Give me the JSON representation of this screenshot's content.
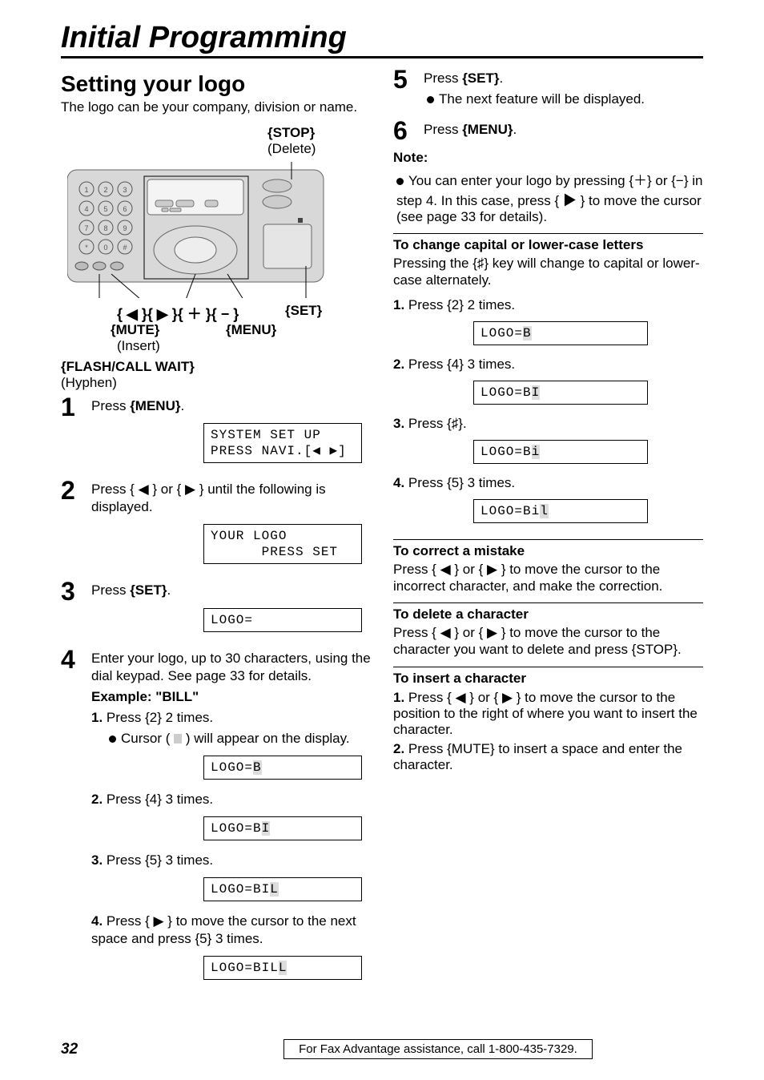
{
  "header": {
    "title": "Initial Programming"
  },
  "left": {
    "heading": "Setting your logo",
    "intro": "The logo can be your company, division or name.",
    "labels": {
      "stop": "{STOP}",
      "stop_sub": "(Delete)",
      "arrows": "{ ◀ }{ ▶ }{ ＋ }{ − }",
      "set": "{SET}",
      "menu": "{MENU}",
      "mute": "{MUTE}",
      "mute_sub": "(Insert)",
      "flash": "{FLASH/CALL WAIT}",
      "flash_sub": "(Hyphen)"
    },
    "step1": {
      "num": "1",
      "text_pre": "Press ",
      "key": "{MENU}",
      "text_post": ".",
      "lcd": "SYSTEM SET UP\nPRESS NAVI.[◀ ▶]"
    },
    "step2": {
      "num": "2",
      "text": "Press { ◀ } or { ▶ } until the following is displayed.",
      "lcd": "YOUR LOGO\n      PRESS SET"
    },
    "step3": {
      "num": "3",
      "text_pre": "Press ",
      "key": "{SET}",
      "text_post": ".",
      "lcd": "LOGO="
    },
    "step4": {
      "num": "4",
      "line1": "Enter your logo, up to 30 characters, using the dial keypad. See page 33 for details.",
      "example": "Example: \"BILL\"",
      "s1": {
        "n": "1.",
        "t": "Press {2} 2 times.",
        "b": "Cursor (  ) will appear on the display.",
        "lcd": "LOGO=",
        "hl": "B"
      },
      "s2": {
        "n": "2.",
        "t": "Press {4} 3 times.",
        "lcd": "LOGO=B",
        "hl": "I"
      },
      "s3": {
        "n": "3.",
        "t": "Press {5} 3 times.",
        "lcd": "LOGO=BI",
        "hl": "L"
      },
      "s4": {
        "n": "4.",
        "t": "Press { ▶ } to move the cursor to the next space and press {5} 3 times.",
        "lcd": "LOGO=BIL",
        "hl": "L"
      }
    }
  },
  "right": {
    "step5": {
      "num": "5",
      "text_pre": "Press ",
      "key": "{SET}",
      "text_post": ".",
      "b": "The next feature will be displayed."
    },
    "step6": {
      "num": "6",
      "text_pre": "Press ",
      "key": "{MENU}",
      "text_post": "."
    },
    "note_head": "Note:",
    "note_body": "You can enter your logo by pressing {＋} or {−} in step 4. In this case, press { ▶ } to move the cursor (see page 33 for details).",
    "caps_head": "To change capital or lower-case letters",
    "caps_body": "Pressing the {♯} key will change to capital or lower-case alternately.",
    "caps": {
      "s1": {
        "n": "1.",
        "t": "Press {2} 2 times.",
        "lcd": "LOGO=",
        "hl": "B"
      },
      "s2": {
        "n": "2.",
        "t": "Press {4} 3 times.",
        "lcd": "LOGO=B",
        "hl": "I"
      },
      "s3": {
        "n": "3.",
        "t": "Press {♯}.",
        "lcd": "LOGO=B",
        "hl": "i"
      },
      "s4": {
        "n": "4.",
        "t": "Press {5} 3 times.",
        "lcd": "LOGO=Bi",
        "hl": "l"
      }
    },
    "correct_head": "To correct a mistake",
    "correct_body": "Press { ◀ } or { ▶ } to move the cursor to the incorrect character, and make the correction.",
    "delete_head": "To delete a character",
    "delete_body": "Press { ◀ } or { ▶ } to move the cursor to the character you want to delete and press {STOP}.",
    "insert_head": "To insert a character",
    "insert": {
      "s1": {
        "n": "1.",
        "t": "Press { ◀ } or { ▶ } to move the cursor to the position to the right of where you want to insert the character."
      },
      "s2": {
        "n": "2.",
        "t": "Press {MUTE} to insert a space and enter the character."
      }
    }
  },
  "footer": {
    "page": "32",
    "text": "For Fax Advantage assistance, call 1-800-435-7329."
  }
}
